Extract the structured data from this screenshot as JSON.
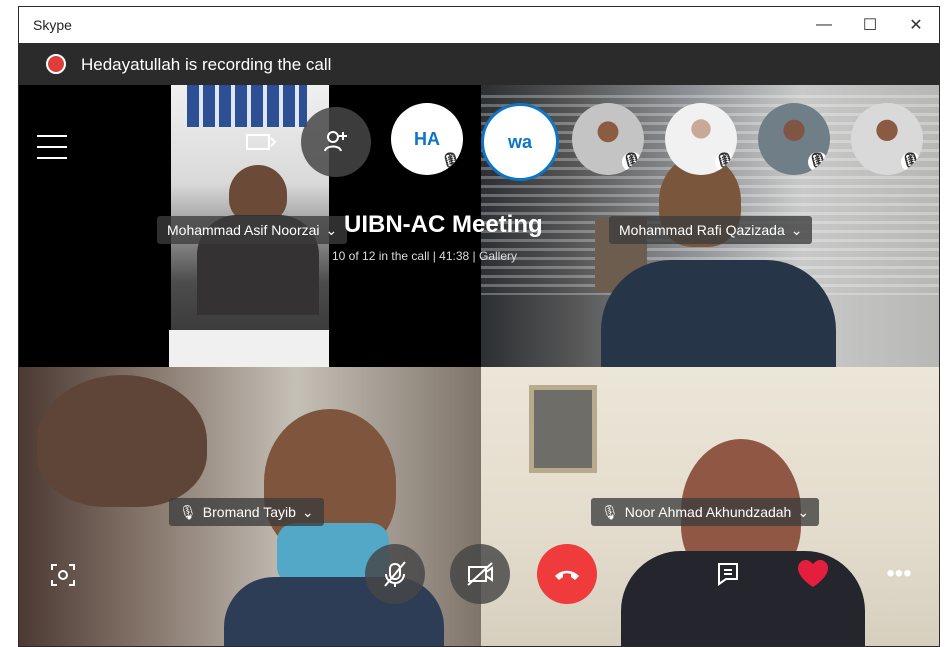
{
  "window": {
    "title": "Skype",
    "controls": [
      "minimize-icon",
      "maximize-icon",
      "close-icon"
    ]
  },
  "recording": {
    "text": "Hedayatullah is recording the call"
  },
  "meeting": {
    "title": "UIBN-AC Meeting",
    "subtitle": "10 of 12 in the call | 41:38 | Gallery"
  },
  "top_avatars": [
    {
      "initials": "HA",
      "color": "#0d75c8",
      "muted": true
    },
    {
      "initials": "wa",
      "color": "#0d75c8",
      "muted": true
    },
    {
      "muted": true
    },
    {
      "muted": true
    },
    {
      "muted": true
    },
    {
      "muted": true
    }
  ],
  "participants": {
    "tile1": "Mohammad Asif Noorzai",
    "tile2": "Mohammad Rafi Qazizada",
    "tile3": "Bromand Tayib",
    "tile4": "Noor Ahmad Akhundzadah"
  },
  "icons": {
    "menu": "hamburger-icon",
    "camera_switch": "camera-switch-icon",
    "add_person": "add-person-icon",
    "screen_capture": "screen-capture-icon",
    "mute": "microphone-muted-icon",
    "video": "video-off-icon",
    "hangup": "hang-up-icon",
    "chat": "chat-icon",
    "reaction": "heart-icon",
    "more": "more-icon"
  },
  "colors": {
    "recording": "#e03c3c",
    "hangup": "#ef3b3b",
    "accent": "#0d75c8",
    "heart": "#e61e3d"
  }
}
